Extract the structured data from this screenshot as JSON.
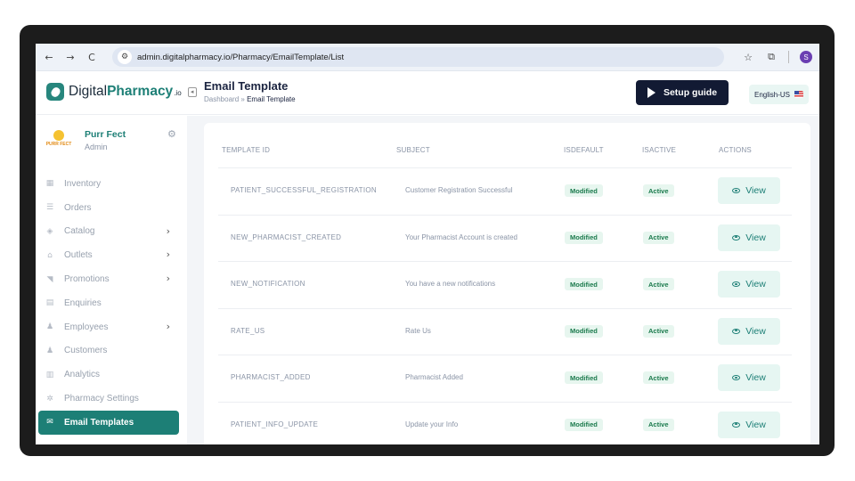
{
  "browser": {
    "nav_icons": [
      "←",
      "→",
      "C"
    ],
    "url": "admin.digitalpharmacy.io/Pharmacy/EmailTemplate/List",
    "profile_initial": "S"
  },
  "header": {
    "logo_plain": "Digital",
    "logo_bold": "Pharmacy",
    "logo_suffix": ".io",
    "title": "Email Template",
    "breadcrumb_root": "Dashboard",
    "breadcrumb_sep": "»",
    "breadcrumb_current": "Email Template",
    "setup_label": "Setup guide",
    "language": "English-US"
  },
  "profile": {
    "logo_text": "PURR FECT",
    "name": "Purr Fect",
    "role": "Admin"
  },
  "sidebar": {
    "items": [
      {
        "label": "Inventory",
        "icon": "inventory-icon",
        "chevron": false
      },
      {
        "label": "Orders",
        "icon": "orders-icon",
        "chevron": false
      },
      {
        "label": "Catalog",
        "icon": "catalog-icon",
        "chevron": true
      },
      {
        "label": "Outlets",
        "icon": "outlets-icon",
        "chevron": true
      },
      {
        "label": "Promotions",
        "icon": "promotions-icon",
        "chevron": true
      },
      {
        "label": "Enquiries",
        "icon": "enquiries-icon",
        "chevron": false
      },
      {
        "label": "Employees",
        "icon": "employees-icon",
        "chevron": true
      },
      {
        "label": "Customers",
        "icon": "customers-icon",
        "chevron": false
      },
      {
        "label": "Analytics",
        "icon": "analytics-icon",
        "chevron": false
      },
      {
        "label": "Pharmacy Settings",
        "icon": "settings-icon",
        "chevron": false
      },
      {
        "label": "Email Templates",
        "icon": "mail-icon",
        "chevron": false,
        "active": true
      }
    ]
  },
  "table": {
    "headers": [
      "TEMPLATE ID",
      "SUBJECT",
      "ISDEFAULT",
      "ISACTIVE",
      "ACTIONS"
    ],
    "view_label": "View",
    "rows": [
      {
        "id": "PATIENT_SUCCESSFUL_REGISTRATION",
        "subject": "Customer Registration Successful",
        "isdefault": "Modified",
        "isactive": "Active"
      },
      {
        "id": "NEW_PHARMACIST_CREATED",
        "subject": "Your Pharmacist Account is created",
        "isdefault": "Modified",
        "isactive": "Active"
      },
      {
        "id": "NEW_NOTIFICATION",
        "subject": "You have a new notifications",
        "isdefault": "Modified",
        "isactive": "Active"
      },
      {
        "id": "RATE_US",
        "subject": "Rate Us",
        "isdefault": "Modified",
        "isactive": "Active"
      },
      {
        "id": "PHARMACIST_ADDED",
        "subject": "Pharmacist Added",
        "isdefault": "Modified",
        "isactive": "Active"
      },
      {
        "id": "PATIENT_INFO_UPDATE",
        "subject": "Update your Info",
        "isdefault": "Modified",
        "isactive": "Active"
      }
    ]
  },
  "colors": {
    "brand": "#1d7f76",
    "dark_button": "#121a33",
    "badge_bg": "#e7f6ef"
  }
}
